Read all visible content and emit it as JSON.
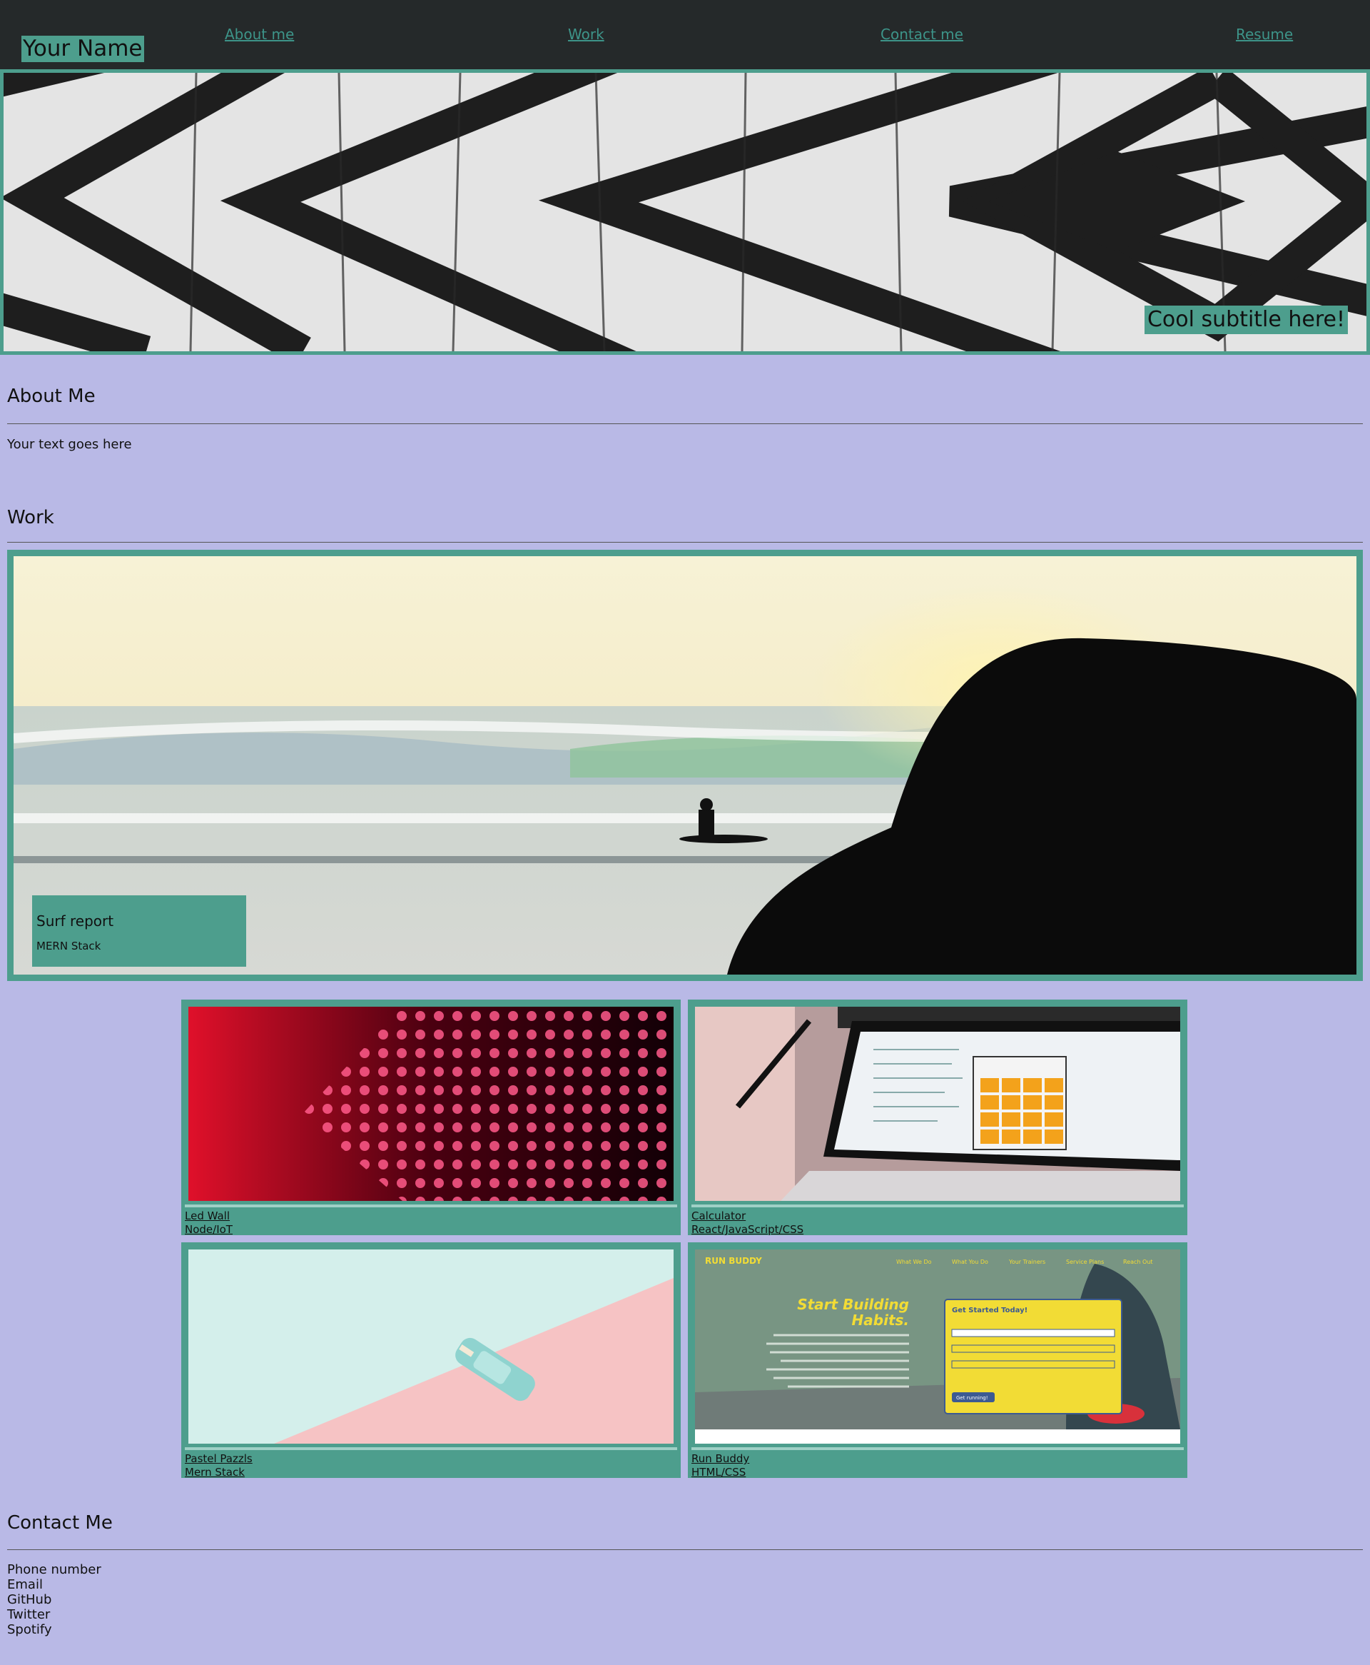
{
  "header": {
    "brand": "Your Name",
    "nav": [
      "About me",
      "Work",
      "Contact me",
      "Resume"
    ]
  },
  "hero": {
    "subtitle": "Cool subtitle here!"
  },
  "about": {
    "heading": "About Me",
    "text": "Your text goes here"
  },
  "work": {
    "heading": "Work",
    "featured": {
      "title": "Surf report",
      "tech": "MERN Stack"
    },
    "projects": [
      {
        "title": "Led Wall",
        "tech": "Node/IoT"
      },
      {
        "title": "Calculator",
        "tech": "React/JavaScript/CSS"
      },
      {
        "title": "Pastel Pazzls",
        "tech": "Mern Stack"
      },
      {
        "title": "Run Buddy",
        "tech": "HTML/CSS"
      }
    ]
  },
  "runbuddy_screenshot": {
    "logo": "RUN BUDDY",
    "nav": [
      "What We Do",
      "What You Do",
      "Your Trainers",
      "Service Plans",
      "Reach Out"
    ],
    "headline": [
      "Start Building",
      "Habits."
    ],
    "form_title": "Get Started Today!",
    "form_button": "Get running!"
  },
  "contact": {
    "heading": "Contact Me",
    "items": [
      "Phone number",
      "Email",
      "GitHub",
      "Twitter",
      "Spotify"
    ]
  },
  "colors": {
    "page_background": "#b9b9e6",
    "header_background": "#25292a",
    "accent": "#4d9e8d",
    "nav_link": "#3d9489"
  }
}
